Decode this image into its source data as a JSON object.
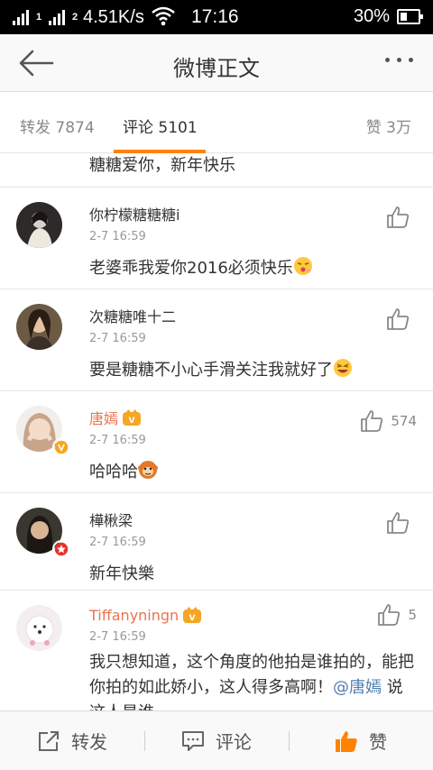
{
  "status_bar": {
    "speed": "4.51K/s",
    "time": "17:16",
    "battery": "30%",
    "sim1": "1",
    "sim2": "2"
  },
  "nav": {
    "title": "微博正文",
    "back_icon": "back-arrow-icon",
    "more_icon": "more-dots-icon"
  },
  "tabs": {
    "repost": "转发 7874",
    "comment": "评论 5101",
    "like": "赞 3万",
    "accent": "#ff8200"
  },
  "partial_comment": {
    "text": "糖糖爱你，新年快乐"
  },
  "comments": [
    {
      "nick": "你柠檬糖糖糖i",
      "time": "2-7 16:59",
      "text": "老婆乖我爱你2016必须快乐",
      "likes": ""
    },
    {
      "nick": "次糖糖唯十二",
      "time": "2-7 16:59",
      "text": "要是糖糖不小心手滑关注我就好了",
      "likes": ""
    },
    {
      "nick": "唐嫣",
      "time": "2-7 16:59",
      "text": "哈哈哈",
      "likes": "574"
    },
    {
      "nick": "樺楸梁",
      "time": "2-7 16:59",
      "text": "新年快樂",
      "likes": ""
    },
    {
      "nick": "Tiffanyningn",
      "time": "2-7 16:59",
      "text": "我只想知道，这个角度的他拍是谁拍的，能把你拍的如此娇小，这人得多高啊！",
      "mention": "@唐嫣",
      "text_tail": " 说这人是谁……",
      "likes": "5"
    }
  ],
  "toolbar": {
    "repost": "转发",
    "comment": "评论",
    "like": "赞"
  },
  "colors": {
    "vip_name": "#eb7350",
    "mention": "#507daf",
    "like_active": "#ff8200"
  }
}
